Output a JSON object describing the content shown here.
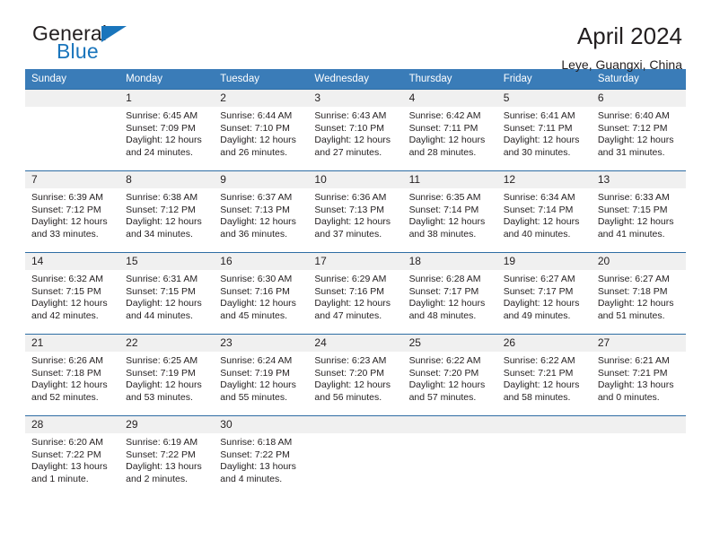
{
  "brand": {
    "name_dark": "General",
    "name_blue": "Blue",
    "accent_color": "#1a75bc"
  },
  "header": {
    "title": "April 2024",
    "subtitle": "Leye, Guangxi, China"
  },
  "theme": {
    "header_row_bg": "#3a7cb8",
    "daynum_band_bg": "#f0f0f0",
    "week_separator": "#2e6da4",
    "text": "#231f20"
  },
  "weekdays": [
    "Sunday",
    "Monday",
    "Tuesday",
    "Wednesday",
    "Thursday",
    "Friday",
    "Saturday"
  ],
  "weeks": [
    [
      {
        "day": "",
        "sunrise": "",
        "sunset": "",
        "daylight1": "",
        "daylight2": ""
      },
      {
        "day": "1",
        "sunrise": "Sunrise: 6:45 AM",
        "sunset": "Sunset: 7:09 PM",
        "daylight1": "Daylight: 12 hours",
        "daylight2": "and 24 minutes."
      },
      {
        "day": "2",
        "sunrise": "Sunrise: 6:44 AM",
        "sunset": "Sunset: 7:10 PM",
        "daylight1": "Daylight: 12 hours",
        "daylight2": "and 26 minutes."
      },
      {
        "day": "3",
        "sunrise": "Sunrise: 6:43 AM",
        "sunset": "Sunset: 7:10 PM",
        "daylight1": "Daylight: 12 hours",
        "daylight2": "and 27 minutes."
      },
      {
        "day": "4",
        "sunrise": "Sunrise: 6:42 AM",
        "sunset": "Sunset: 7:11 PM",
        "daylight1": "Daylight: 12 hours",
        "daylight2": "and 28 minutes."
      },
      {
        "day": "5",
        "sunrise": "Sunrise: 6:41 AM",
        "sunset": "Sunset: 7:11 PM",
        "daylight1": "Daylight: 12 hours",
        "daylight2": "and 30 minutes."
      },
      {
        "day": "6",
        "sunrise": "Sunrise: 6:40 AM",
        "sunset": "Sunset: 7:12 PM",
        "daylight1": "Daylight: 12 hours",
        "daylight2": "and 31 minutes."
      }
    ],
    [
      {
        "day": "7",
        "sunrise": "Sunrise: 6:39 AM",
        "sunset": "Sunset: 7:12 PM",
        "daylight1": "Daylight: 12 hours",
        "daylight2": "and 33 minutes."
      },
      {
        "day": "8",
        "sunrise": "Sunrise: 6:38 AM",
        "sunset": "Sunset: 7:12 PM",
        "daylight1": "Daylight: 12 hours",
        "daylight2": "and 34 minutes."
      },
      {
        "day": "9",
        "sunrise": "Sunrise: 6:37 AM",
        "sunset": "Sunset: 7:13 PM",
        "daylight1": "Daylight: 12 hours",
        "daylight2": "and 36 minutes."
      },
      {
        "day": "10",
        "sunrise": "Sunrise: 6:36 AM",
        "sunset": "Sunset: 7:13 PM",
        "daylight1": "Daylight: 12 hours",
        "daylight2": "and 37 minutes."
      },
      {
        "day": "11",
        "sunrise": "Sunrise: 6:35 AM",
        "sunset": "Sunset: 7:14 PM",
        "daylight1": "Daylight: 12 hours",
        "daylight2": "and 38 minutes."
      },
      {
        "day": "12",
        "sunrise": "Sunrise: 6:34 AM",
        "sunset": "Sunset: 7:14 PM",
        "daylight1": "Daylight: 12 hours",
        "daylight2": "and 40 minutes."
      },
      {
        "day": "13",
        "sunrise": "Sunrise: 6:33 AM",
        "sunset": "Sunset: 7:15 PM",
        "daylight1": "Daylight: 12 hours",
        "daylight2": "and 41 minutes."
      }
    ],
    [
      {
        "day": "14",
        "sunrise": "Sunrise: 6:32 AM",
        "sunset": "Sunset: 7:15 PM",
        "daylight1": "Daylight: 12 hours",
        "daylight2": "and 42 minutes."
      },
      {
        "day": "15",
        "sunrise": "Sunrise: 6:31 AM",
        "sunset": "Sunset: 7:15 PM",
        "daylight1": "Daylight: 12 hours",
        "daylight2": "and 44 minutes."
      },
      {
        "day": "16",
        "sunrise": "Sunrise: 6:30 AM",
        "sunset": "Sunset: 7:16 PM",
        "daylight1": "Daylight: 12 hours",
        "daylight2": "and 45 minutes."
      },
      {
        "day": "17",
        "sunrise": "Sunrise: 6:29 AM",
        "sunset": "Sunset: 7:16 PM",
        "daylight1": "Daylight: 12 hours",
        "daylight2": "and 47 minutes."
      },
      {
        "day": "18",
        "sunrise": "Sunrise: 6:28 AM",
        "sunset": "Sunset: 7:17 PM",
        "daylight1": "Daylight: 12 hours",
        "daylight2": "and 48 minutes."
      },
      {
        "day": "19",
        "sunrise": "Sunrise: 6:27 AM",
        "sunset": "Sunset: 7:17 PM",
        "daylight1": "Daylight: 12 hours",
        "daylight2": "and 49 minutes."
      },
      {
        "day": "20",
        "sunrise": "Sunrise: 6:27 AM",
        "sunset": "Sunset: 7:18 PM",
        "daylight1": "Daylight: 12 hours",
        "daylight2": "and 51 minutes."
      }
    ],
    [
      {
        "day": "21",
        "sunrise": "Sunrise: 6:26 AM",
        "sunset": "Sunset: 7:18 PM",
        "daylight1": "Daylight: 12 hours",
        "daylight2": "and 52 minutes."
      },
      {
        "day": "22",
        "sunrise": "Sunrise: 6:25 AM",
        "sunset": "Sunset: 7:19 PM",
        "daylight1": "Daylight: 12 hours",
        "daylight2": "and 53 minutes."
      },
      {
        "day": "23",
        "sunrise": "Sunrise: 6:24 AM",
        "sunset": "Sunset: 7:19 PM",
        "daylight1": "Daylight: 12 hours",
        "daylight2": "and 55 minutes."
      },
      {
        "day": "24",
        "sunrise": "Sunrise: 6:23 AM",
        "sunset": "Sunset: 7:20 PM",
        "daylight1": "Daylight: 12 hours",
        "daylight2": "and 56 minutes."
      },
      {
        "day": "25",
        "sunrise": "Sunrise: 6:22 AM",
        "sunset": "Sunset: 7:20 PM",
        "daylight1": "Daylight: 12 hours",
        "daylight2": "and 57 minutes."
      },
      {
        "day": "26",
        "sunrise": "Sunrise: 6:22 AM",
        "sunset": "Sunset: 7:21 PM",
        "daylight1": "Daylight: 12 hours",
        "daylight2": "and 58 minutes."
      },
      {
        "day": "27",
        "sunrise": "Sunrise: 6:21 AM",
        "sunset": "Sunset: 7:21 PM",
        "daylight1": "Daylight: 13 hours",
        "daylight2": "and 0 minutes."
      }
    ],
    [
      {
        "day": "28",
        "sunrise": "Sunrise: 6:20 AM",
        "sunset": "Sunset: 7:22 PM",
        "daylight1": "Daylight: 13 hours",
        "daylight2": "and 1 minute."
      },
      {
        "day": "29",
        "sunrise": "Sunrise: 6:19 AM",
        "sunset": "Sunset: 7:22 PM",
        "daylight1": "Daylight: 13 hours",
        "daylight2": "and 2 minutes."
      },
      {
        "day": "30",
        "sunrise": "Sunrise: 6:18 AM",
        "sunset": "Sunset: 7:22 PM",
        "daylight1": "Daylight: 13 hours",
        "daylight2": "and 4 minutes."
      },
      {
        "day": "",
        "sunrise": "",
        "sunset": "",
        "daylight1": "",
        "daylight2": ""
      },
      {
        "day": "",
        "sunrise": "",
        "sunset": "",
        "daylight1": "",
        "daylight2": ""
      },
      {
        "day": "",
        "sunrise": "",
        "sunset": "",
        "daylight1": "",
        "daylight2": ""
      },
      {
        "day": "",
        "sunrise": "",
        "sunset": "",
        "daylight1": "",
        "daylight2": ""
      }
    ]
  ]
}
